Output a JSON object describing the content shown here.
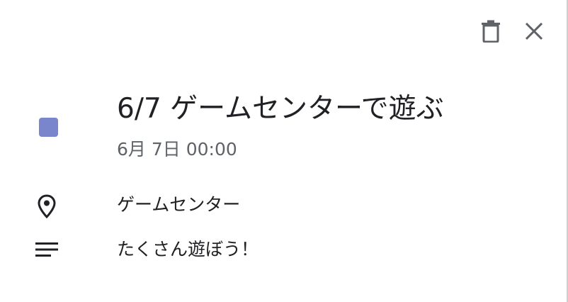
{
  "event": {
    "title": "6/7 ゲームセンターで遊ぶ",
    "datetime": "6月 7日 00:00",
    "color": "#7986cb",
    "location": "ゲームセンター",
    "description": "たくさん遊ぼう！"
  },
  "toolbar": {
    "delete_icon": "trash-icon",
    "close_icon": "close-icon"
  },
  "icons": {
    "location": "location-pin-icon",
    "description": "notes-lines-icon"
  }
}
